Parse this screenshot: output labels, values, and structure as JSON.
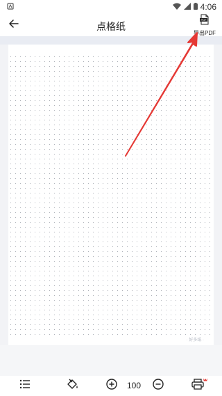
{
  "status_bar": {
    "time": "4:06"
  },
  "app_bar": {
    "title": "点格纸",
    "pdf_button_label": "导出PDF"
  },
  "paper": {
    "watermark": "· 好多纸 ·"
  },
  "bottom_bar": {
    "zoom_value": "100"
  },
  "annotation": {
    "arrow_color": "#e53935"
  }
}
